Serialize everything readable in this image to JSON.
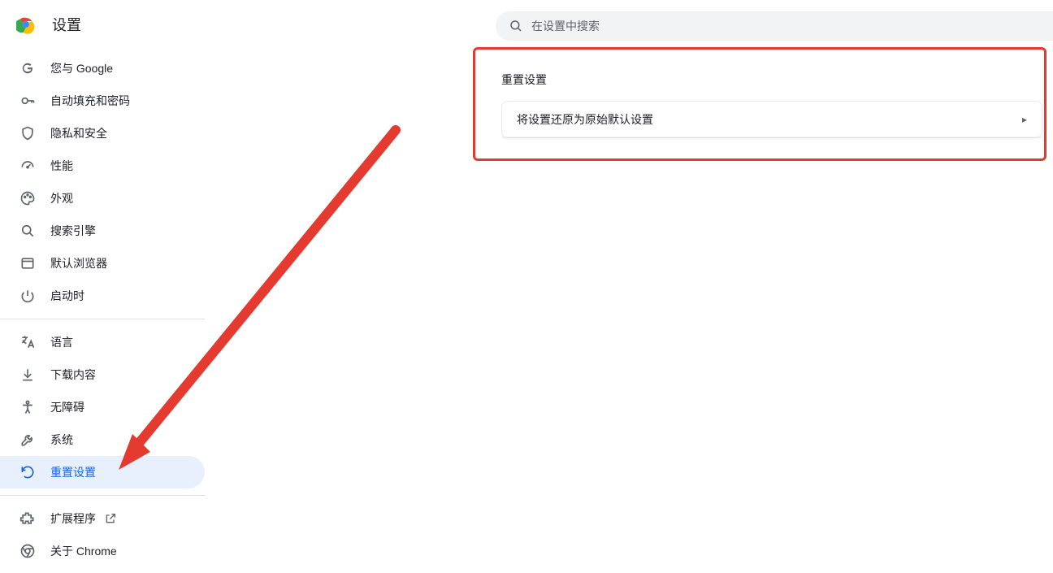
{
  "header": {
    "title": "设置"
  },
  "search": {
    "placeholder": "在设置中搜索"
  },
  "sidebar": {
    "group1": [
      {
        "id": "you-and-google",
        "label": "您与 Google"
      },
      {
        "id": "autofill",
        "label": "自动填充和密码"
      },
      {
        "id": "privacy",
        "label": "隐私和安全"
      },
      {
        "id": "performance",
        "label": "性能"
      },
      {
        "id": "appearance",
        "label": "外观"
      },
      {
        "id": "search-engine",
        "label": "搜索引擎"
      },
      {
        "id": "default-browser",
        "label": "默认浏览器"
      },
      {
        "id": "on-startup",
        "label": "启动时"
      }
    ],
    "group2": [
      {
        "id": "languages",
        "label": "语言"
      },
      {
        "id": "downloads",
        "label": "下载内容"
      },
      {
        "id": "accessibility",
        "label": "无障碍"
      },
      {
        "id": "system",
        "label": "系统"
      },
      {
        "id": "reset",
        "label": "重置设置",
        "active": true
      }
    ],
    "group3": [
      {
        "id": "extensions",
        "label": "扩展程序",
        "external": true
      },
      {
        "id": "about-chrome",
        "label": "关于 Chrome"
      }
    ]
  },
  "main": {
    "section_title": "重置设置",
    "card": {
      "label": "将设置还原为原始默认设置"
    }
  },
  "annotation": {
    "highlight": true,
    "arrow": true
  }
}
